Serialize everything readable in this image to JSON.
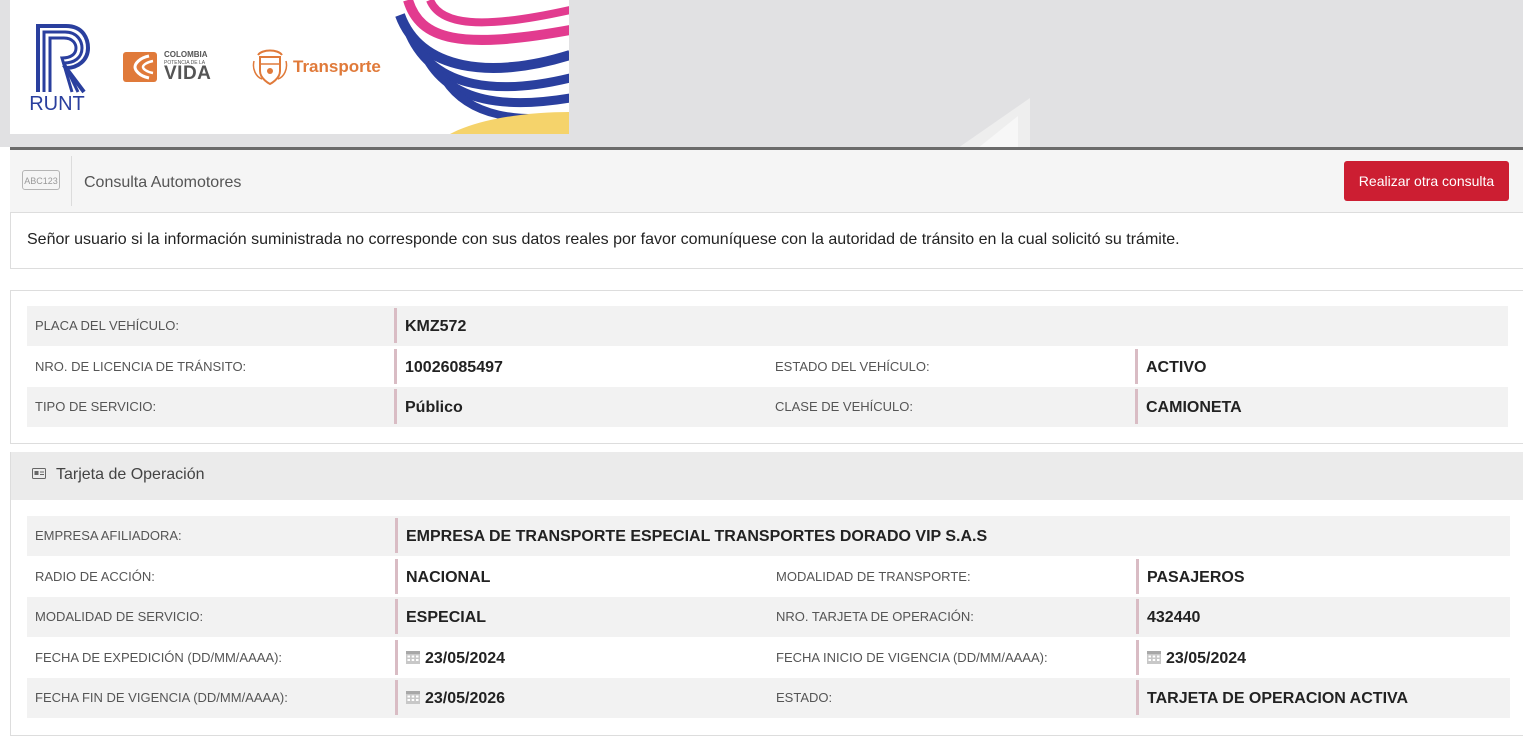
{
  "header": {
    "runt_label": "RUNT",
    "colombia_line1": "COLOMBIA",
    "colombia_line2": "POTENCIA DE LA",
    "colombia_line3": "VIDA",
    "transporte_label": "Transporte"
  },
  "consulta": {
    "icon_text": "ABC123",
    "title": "Consulta Automotores",
    "button_label": "Realizar otra consulta"
  },
  "notice": "Señor usuario si la información suministrada no corresponde con sus datos reales por favor comuníquese con la autoridad de tránsito en la cual solicitó su trámite.",
  "vehiculo": {
    "placa_label": "PLACA DEL VEHÍCULO:",
    "placa_value": "KMZ572",
    "licencia_label": "NRO. DE LICENCIA DE TRÁNSITO:",
    "licencia_value": "10026085497",
    "estado_label": "ESTADO DEL VEHÍCULO:",
    "estado_value": "ACTIVO",
    "servicio_label": "TIPO DE SERVICIO:",
    "servicio_value": "Público",
    "clase_label": "CLASE DE VEHÍCULO:",
    "clase_value": "CAMIONETA"
  },
  "tarjeta": {
    "title": "Tarjeta de Operación",
    "empresa_label": "EMPRESA AFILIADORA:",
    "empresa_value": "EMPRESA DE TRANSPORTE ESPECIAL TRANSPORTES DORADO VIP S.A.S",
    "radio_label": "RADIO DE ACCIÓN:",
    "radio_value": "NACIONAL",
    "mod_transporte_label": "MODALIDAD DE TRANSPORTE:",
    "mod_transporte_value": "PASAJEROS",
    "mod_servicio_label": "MODALIDAD DE SERVICIO:",
    "mod_servicio_value": "ESPECIAL",
    "nro_tarjeta_label": "NRO. TARJETA DE OPERACIÓN:",
    "nro_tarjeta_value": "432440",
    "fecha_exp_label": "FECHA DE EXPEDICIÓN (DD/MM/AAAA):",
    "fecha_exp_value": "23/05/2024",
    "fecha_ini_label": "FECHA INICIO DE VIGENCIA (DD/MM/AAAA):",
    "fecha_ini_value": "23/05/2024",
    "fecha_fin_label": "FECHA FIN DE VIGENCIA (DD/MM/AAAA):",
    "fecha_fin_value": "23/05/2026",
    "estado_label": "ESTADO:",
    "estado_value": "TARJETA DE OPERACION ACTIVA"
  },
  "colors": {
    "accent_red": "#cc1e32",
    "runt_blue": "#2a3f9e",
    "transporte_orange": "#e07a3a",
    "value_bar": "#d9bcc4"
  }
}
